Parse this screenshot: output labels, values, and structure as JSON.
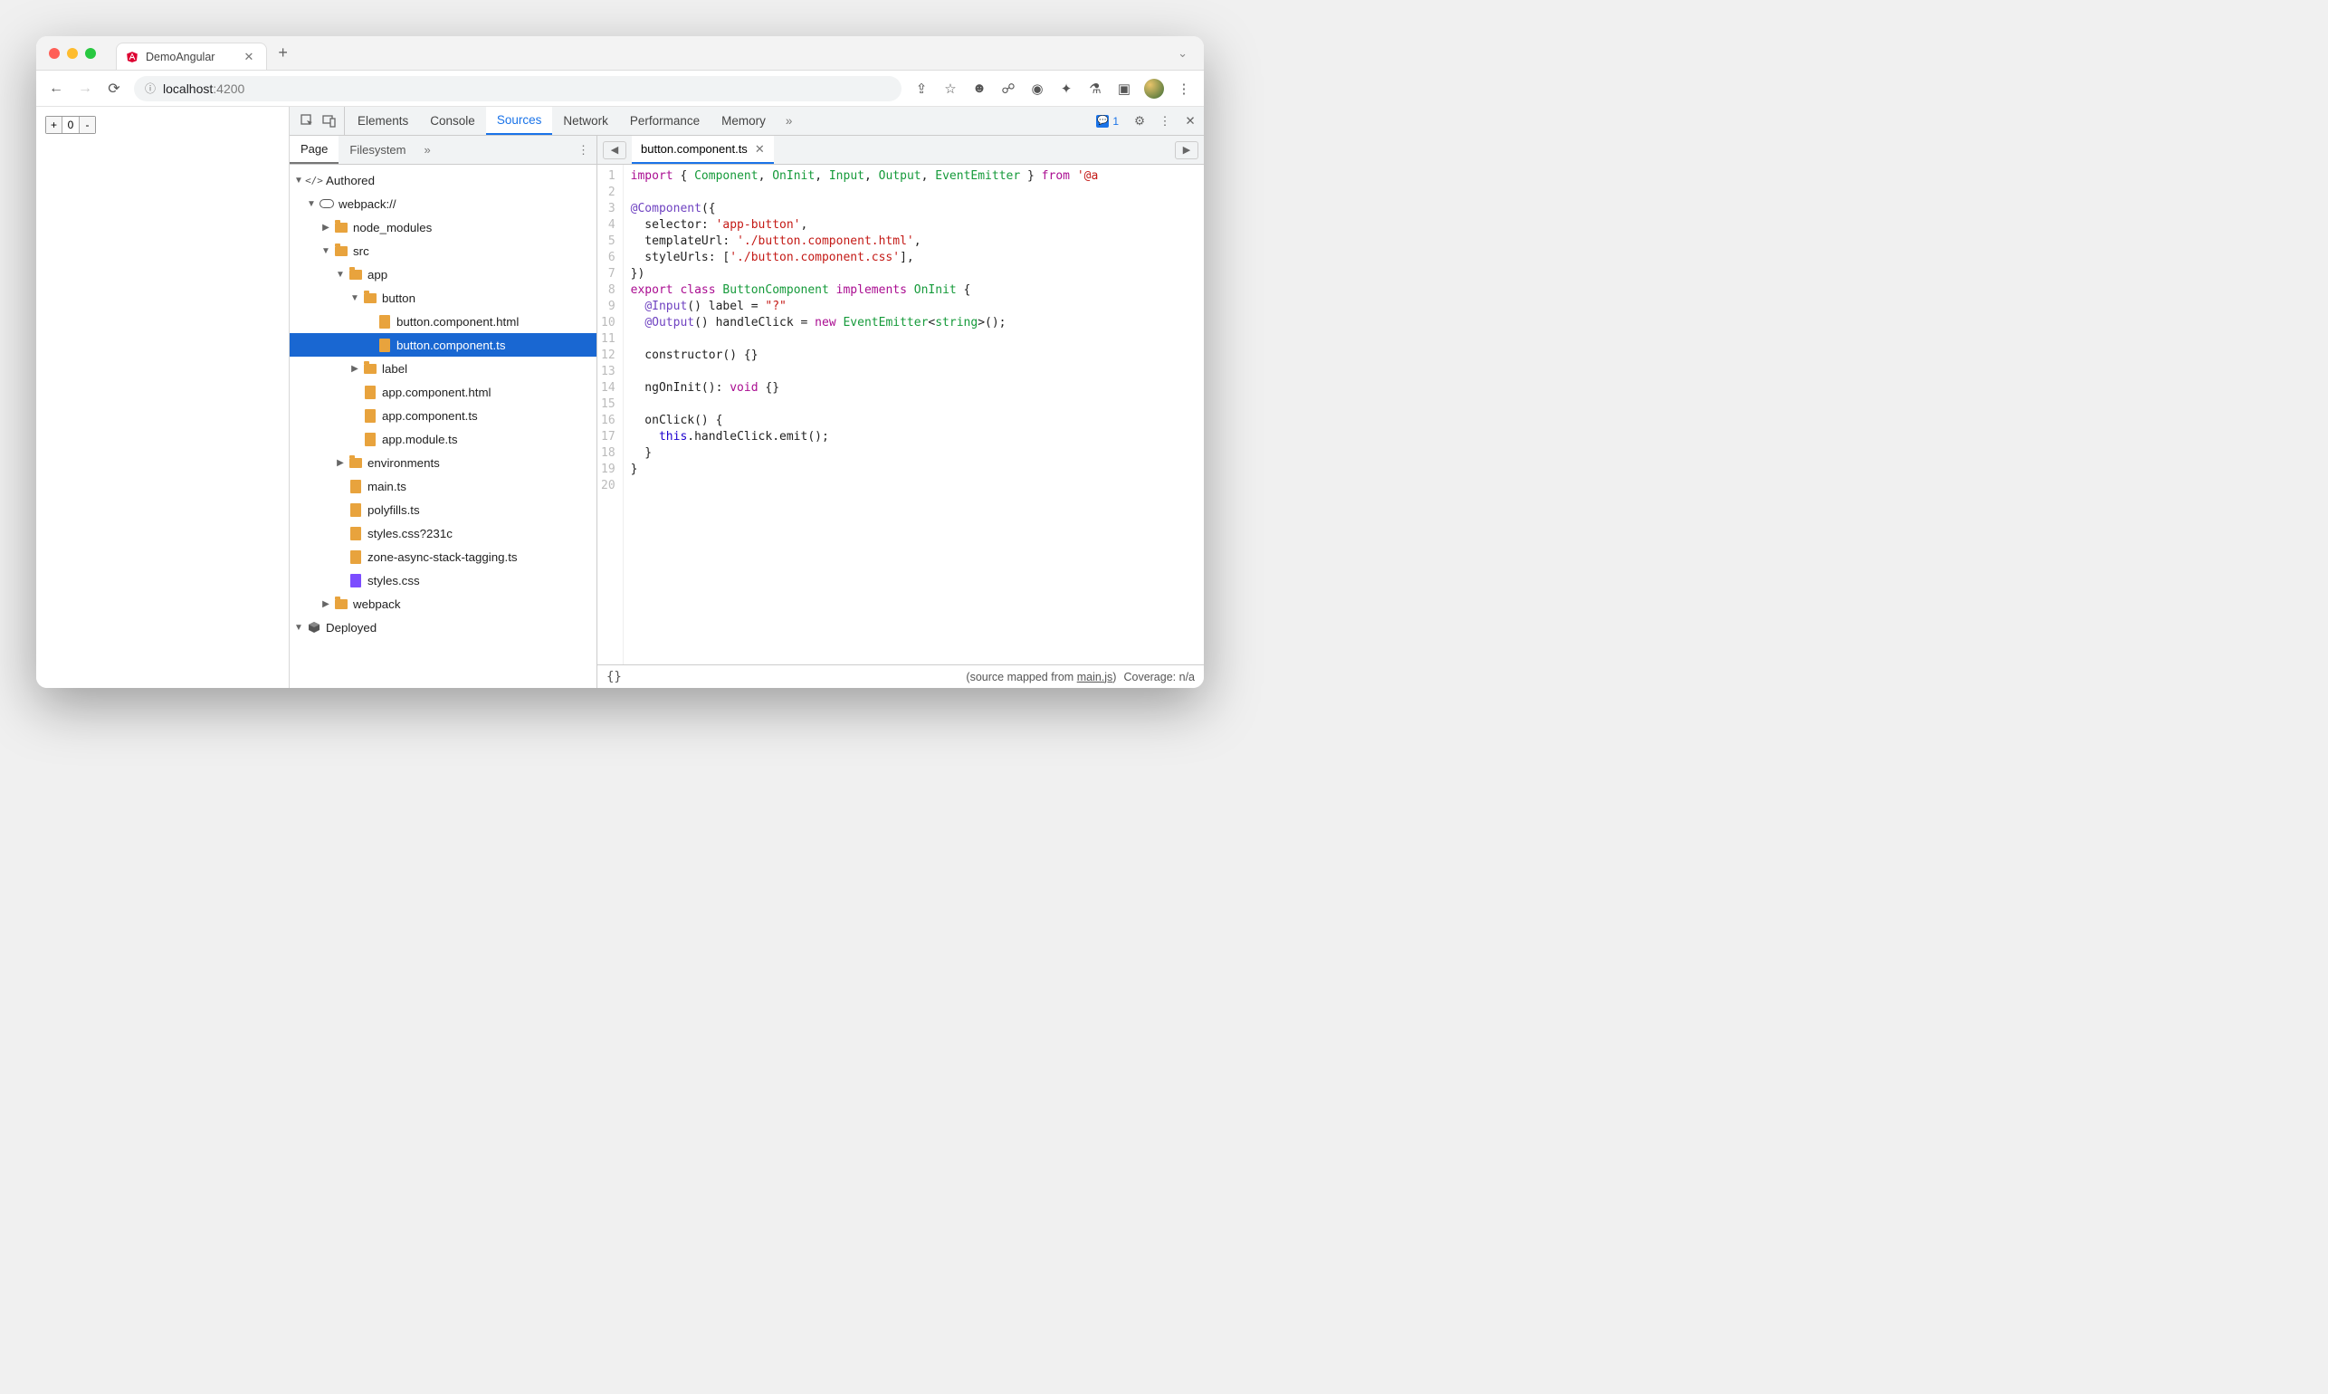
{
  "browser": {
    "tab_title": "DemoAngular",
    "url_host": "localhost",
    "url_rest": ":4200"
  },
  "page": {
    "counter_value": "0"
  },
  "devtools": {
    "tabs": [
      "Elements",
      "Console",
      "Sources",
      "Network",
      "Performance",
      "Memory"
    ],
    "active_tab": "Sources",
    "issues_count": "1"
  },
  "sources_sidebar": {
    "tabs": [
      "Page",
      "Filesystem"
    ],
    "active_tab": "Page",
    "tree": [
      {
        "label": "Authored",
        "depth": 0,
        "icon": "authored",
        "arrow": "down"
      },
      {
        "label": "webpack://",
        "depth": 1,
        "icon": "cloud",
        "arrow": "down"
      },
      {
        "label": "node_modules",
        "depth": 2,
        "icon": "folder",
        "arrow": "right"
      },
      {
        "label": "src",
        "depth": 2,
        "icon": "folder",
        "arrow": "down"
      },
      {
        "label": "app",
        "depth": 3,
        "icon": "folder",
        "arrow": "down"
      },
      {
        "label": "button",
        "depth": 4,
        "icon": "folder",
        "arrow": "down"
      },
      {
        "label": "button.component.html",
        "depth": 5,
        "icon": "file-y",
        "arrow": ""
      },
      {
        "label": "button.component.ts",
        "depth": 5,
        "icon": "file-y",
        "arrow": "",
        "selected": true
      },
      {
        "label": "label",
        "depth": 4,
        "icon": "folder",
        "arrow": "right"
      },
      {
        "label": "app.component.html",
        "depth": 4,
        "icon": "file-y",
        "arrow": ""
      },
      {
        "label": "app.component.ts",
        "depth": 4,
        "icon": "file-y",
        "arrow": ""
      },
      {
        "label": "app.module.ts",
        "depth": 4,
        "icon": "file-y",
        "arrow": ""
      },
      {
        "label": "environments",
        "depth": 3,
        "icon": "folder",
        "arrow": "right"
      },
      {
        "label": "main.ts",
        "depth": 3,
        "icon": "file-y",
        "arrow": ""
      },
      {
        "label": "polyfills.ts",
        "depth": 3,
        "icon": "file-y",
        "arrow": ""
      },
      {
        "label": "styles.css?231c",
        "depth": 3,
        "icon": "file-y",
        "arrow": ""
      },
      {
        "label": "zone-async-stack-tagging.ts",
        "depth": 3,
        "icon": "file-y",
        "arrow": ""
      },
      {
        "label": "styles.css",
        "depth": 3,
        "icon": "file-p",
        "arrow": ""
      },
      {
        "label": "webpack",
        "depth": 2,
        "icon": "folder",
        "arrow": "right"
      },
      {
        "label": "Deployed",
        "depth": 0,
        "icon": "cube",
        "arrow": "down"
      }
    ]
  },
  "editor": {
    "open_file": "button.component.ts",
    "line_count": 20,
    "code_lines": [
      [
        {
          "t": "import",
          "c": "kw-r"
        },
        {
          "t": " { "
        },
        {
          "t": "Component",
          "c": "type"
        },
        {
          "t": ", "
        },
        {
          "t": "OnInit",
          "c": "type"
        },
        {
          "t": ", "
        },
        {
          "t": "Input",
          "c": "type"
        },
        {
          "t": ", "
        },
        {
          "t": "Output",
          "c": "type"
        },
        {
          "t": ", "
        },
        {
          "t": "EventEmitter",
          "c": "type"
        },
        {
          "t": " } "
        },
        {
          "t": "from",
          "c": "kw-r"
        },
        {
          "t": " "
        },
        {
          "t": "'@a",
          "c": "str"
        }
      ],
      [],
      [
        {
          "t": "@Component",
          "c": "dec"
        },
        {
          "t": "({"
        }
      ],
      [
        {
          "t": "  selector: "
        },
        {
          "t": "'app-button'",
          "c": "str"
        },
        {
          "t": ","
        }
      ],
      [
        {
          "t": "  templateUrl: "
        },
        {
          "t": "'./button.component.html'",
          "c": "str"
        },
        {
          "t": ","
        }
      ],
      [
        {
          "t": "  styleUrls: ["
        },
        {
          "t": "'./button.component.css'",
          "c": "str"
        },
        {
          "t": "],"
        }
      ],
      [
        {
          "t": "})"
        }
      ],
      [
        {
          "t": "export",
          "c": "kw-r"
        },
        {
          "t": " "
        },
        {
          "t": "class",
          "c": "kw-r"
        },
        {
          "t": " "
        },
        {
          "t": "ButtonComponent",
          "c": "type"
        },
        {
          "t": " "
        },
        {
          "t": "implements",
          "c": "kw-r"
        },
        {
          "t": " "
        },
        {
          "t": "OnInit",
          "c": "type"
        },
        {
          "t": " {"
        }
      ],
      [
        {
          "t": "  "
        },
        {
          "t": "@Input",
          "c": "dec"
        },
        {
          "t": "() label = "
        },
        {
          "t": "\"?\"",
          "c": "str"
        }
      ],
      [
        {
          "t": "  "
        },
        {
          "t": "@Output",
          "c": "dec"
        },
        {
          "t": "() handleClick = "
        },
        {
          "t": "new",
          "c": "kw-r"
        },
        {
          "t": " "
        },
        {
          "t": "EventEmitter",
          "c": "type"
        },
        {
          "t": "<"
        },
        {
          "t": "string",
          "c": "type"
        },
        {
          "t": ">();"
        }
      ],
      [],
      [
        {
          "t": "  constructor() {}"
        }
      ],
      [],
      [
        {
          "t": "  ngOnInit(): "
        },
        {
          "t": "void",
          "c": "kw-r"
        },
        {
          "t": " {}"
        }
      ],
      [],
      [
        {
          "t": "  onClick() {"
        }
      ],
      [
        {
          "t": "    "
        },
        {
          "t": "this",
          "c": "this"
        },
        {
          "t": ".handleClick.emit();"
        }
      ],
      [
        {
          "t": "  }"
        }
      ],
      [
        {
          "t": "}"
        }
      ],
      []
    ]
  },
  "status": {
    "mapped_prefix": "(source mapped from ",
    "mapped_file": "main.js",
    "mapped_suffix": ")",
    "coverage": "Coverage: n/a"
  }
}
